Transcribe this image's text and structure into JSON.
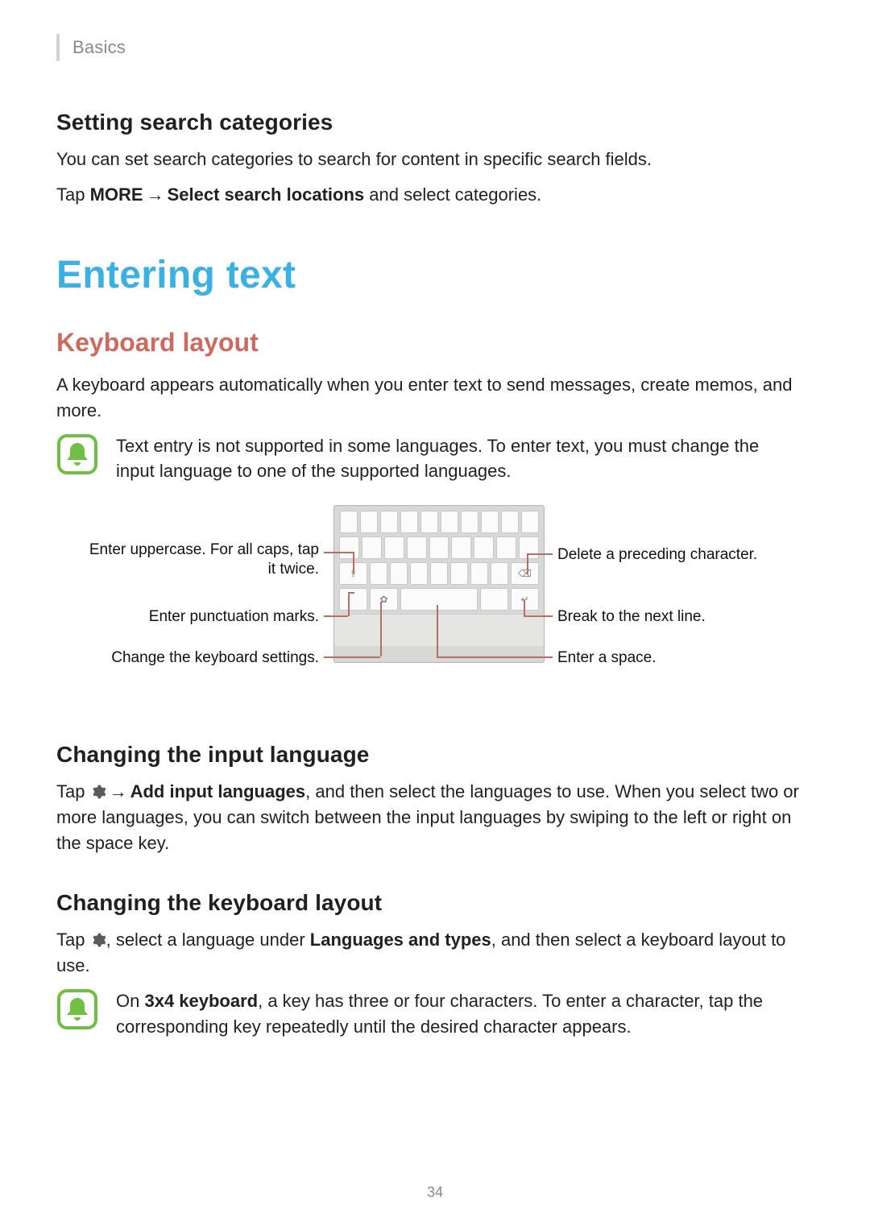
{
  "header": {
    "breadcrumb": "Basics"
  },
  "section1": {
    "heading": "Setting search categories",
    "p1": "You can set search categories to search for content in specific search fields.",
    "p2_pre": "Tap ",
    "p2_more": "MORE",
    "p2_arrow": " → ",
    "p2_select": "Select search locations",
    "p2_post": " and select categories."
  },
  "h1": "Entering text",
  "h2": "Keyboard layout",
  "kl_p1": "A keyboard appears automatically when you enter text to send messages, create memos, and more.",
  "note1": "Text entry is not supported in some languages. To enter text, you must change the input language to one of the supported languages.",
  "callouts": {
    "l1a": "Enter uppercase. For all caps, tap",
    "l1b": "it twice.",
    "l2": "Enter punctuation marks.",
    "l3": "Change the keyboard settings.",
    "r1": "Delete a preceding character.",
    "r2": "Break to the next line.",
    "r3": "Enter a space."
  },
  "section3": {
    "heading": "Changing the input language",
    "pre": "Tap ",
    "arrow": " → ",
    "add": "Add input languages",
    "post": ", and then select the languages to use. When you select two or more languages, you can switch between the input languages by swiping to the left or right on the space key."
  },
  "section4": {
    "heading": "Changing the keyboard layout",
    "pre": "Tap ",
    "mid1": ", select a language under ",
    "lt": "Languages and types",
    "post": ", and then select a keyboard layout to use."
  },
  "note2_pre": "On ",
  "note2_b": "3x4 keyboard",
  "note2_post": ", a key has three or four characters. To enter a character, tap the corresponding key repeatedly until the desired character appears.",
  "pagenum": "34"
}
